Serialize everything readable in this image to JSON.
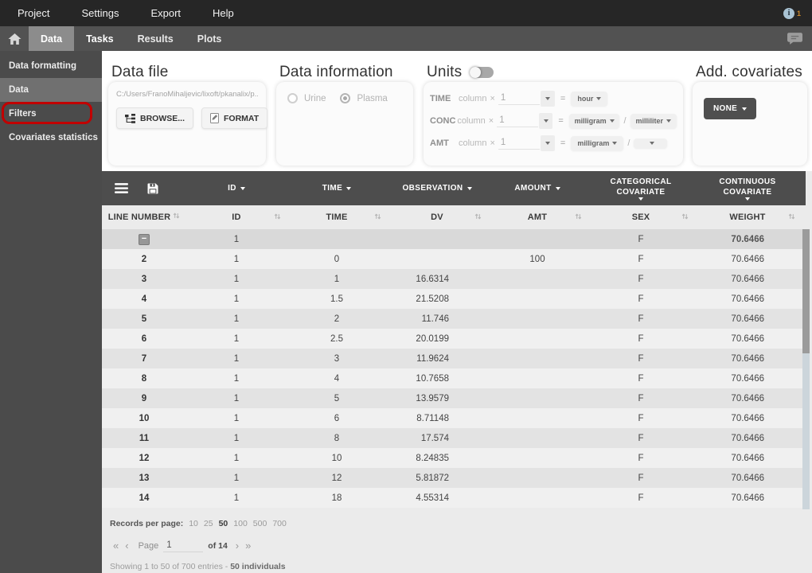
{
  "menubar": {
    "items": [
      "Project",
      "Settings",
      "Export",
      "Help"
    ],
    "info_badge": "1"
  },
  "tabbar": {
    "tabs": [
      "Data",
      "Tasks",
      "Results",
      "Plots"
    ],
    "active": "Data"
  },
  "sidebar": {
    "items": [
      {
        "label": "Data formatting",
        "active": false
      },
      {
        "label": "Data",
        "active": true
      },
      {
        "label": "Filters",
        "active": false,
        "annotated": true
      },
      {
        "label": "Covariates statistics",
        "active": false
      }
    ]
  },
  "datafile": {
    "title": "Data file",
    "path": "C:/Users/FranoMihaljevic/lixoft/pkanalix/p...",
    "browse_label": "BROWSE...",
    "format_label": "FORMAT"
  },
  "datainfo": {
    "title": "Data information",
    "options": [
      {
        "label": "Urine",
        "selected": false
      },
      {
        "label": "Plasma",
        "selected": true
      }
    ]
  },
  "units": {
    "title": "Units",
    "toggle_on": false,
    "rows": [
      {
        "label": "TIME",
        "column_word": "column",
        "multiply": "×",
        "factor": "1",
        "equals": "=",
        "numerator": "hour",
        "divider": "",
        "denominator": null
      },
      {
        "label": "CONC",
        "column_word": "column",
        "multiply": "×",
        "factor": "1",
        "equals": "=",
        "numerator": "milligram",
        "divider": "/",
        "denominator": "milliliter"
      },
      {
        "label": "AMT",
        "column_word": "column",
        "multiply": "×",
        "factor": "1",
        "equals": "=",
        "numerator": "milligram",
        "divider": "/",
        "denominator": ""
      }
    ]
  },
  "covariates": {
    "title": "Add. covariates",
    "button_label": "NONE"
  },
  "table": {
    "collapse_glyph": "−",
    "group_headers": [
      "ID",
      "TIME",
      "OBSERVATION",
      "AMOUNT",
      "CATEGORICAL COVARIATE",
      "CONTINUOUS COVARIATE"
    ],
    "columns": [
      "LINE NUMBER",
      "ID",
      "TIME",
      "DV",
      "AMT",
      "SEX",
      "WEIGHT"
    ],
    "rows": [
      {
        "line": "",
        "id": "1",
        "time": "",
        "dv": "",
        "amt": "",
        "sex": "F",
        "weight": "70.6466",
        "collapse": true,
        "emph": true
      },
      {
        "line": "2",
        "id": "1",
        "time": "0",
        "dv": "",
        "amt": "100",
        "sex": "F",
        "weight": "70.6466"
      },
      {
        "line": "3",
        "id": "1",
        "time": "1",
        "dv": "16.6314",
        "amt": "",
        "sex": "F",
        "weight": "70.6466"
      },
      {
        "line": "4",
        "id": "1",
        "time": "1.5",
        "dv": "21.5208",
        "amt": "",
        "sex": "F",
        "weight": "70.6466"
      },
      {
        "line": "5",
        "id": "1",
        "time": "2",
        "dv": "11.746",
        "amt": "",
        "sex": "F",
        "weight": "70.6466"
      },
      {
        "line": "6",
        "id": "1",
        "time": "2.5",
        "dv": "20.0199",
        "amt": "",
        "sex": "F",
        "weight": "70.6466"
      },
      {
        "line": "7",
        "id": "1",
        "time": "3",
        "dv": "11.9624",
        "amt": "",
        "sex": "F",
        "weight": "70.6466"
      },
      {
        "line": "8",
        "id": "1",
        "time": "4",
        "dv": "10.7658",
        "amt": "",
        "sex": "F",
        "weight": "70.6466"
      },
      {
        "line": "9",
        "id": "1",
        "time": "5",
        "dv": "13.9579",
        "amt": "",
        "sex": "F",
        "weight": "70.6466"
      },
      {
        "line": "10",
        "id": "1",
        "time": "6",
        "dv": "8.71148",
        "amt": "",
        "sex": "F",
        "weight": "70.6466"
      },
      {
        "line": "11",
        "id": "1",
        "time": "8",
        "dv": "17.574",
        "amt": "",
        "sex": "F",
        "weight": "70.6466"
      },
      {
        "line": "12",
        "id": "1",
        "time": "10",
        "dv": "8.24835",
        "amt": "",
        "sex": "F",
        "weight": "70.6466"
      },
      {
        "line": "13",
        "id": "1",
        "time": "12",
        "dv": "5.81872",
        "amt": "",
        "sex": "F",
        "weight": "70.6466"
      },
      {
        "line": "14",
        "id": "1",
        "time": "18",
        "dv": "4.55314",
        "amt": "",
        "sex": "F",
        "weight": "70.6466"
      }
    ]
  },
  "footer": {
    "records_label": "Records per page:",
    "page_sizes": [
      "10",
      "25",
      "50",
      "100",
      "500",
      "700"
    ],
    "selected_size": "50",
    "first_glyph": "«",
    "prev_glyph": "‹",
    "next_glyph": "›",
    "last_glyph": "»",
    "page_label": "Page",
    "page_value": "1",
    "of_label": "of 14",
    "showing_text": "Showing 1 to 50 of 700 entries - ",
    "individuals_text": "50 individuals"
  },
  "colors": {
    "accent_red": "#c10000",
    "header_dark": "#4d4d4d",
    "info_badge_orange": "#c8862b"
  }
}
